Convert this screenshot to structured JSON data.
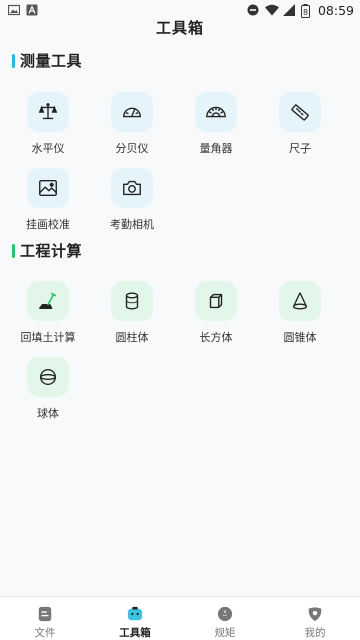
{
  "status_bar": {
    "time": "08:59",
    "battery_level": "8"
  },
  "header": {
    "title": "工具箱"
  },
  "sections": [
    {
      "title": "测量工具",
      "accent": "#2ab7e0",
      "tools": [
        {
          "label": "水平仪",
          "icon": "level-scale-icon"
        },
        {
          "label": "分贝仪",
          "icon": "decibel-meter-icon"
        },
        {
          "label": "量角器",
          "icon": "protractor-icon"
        },
        {
          "label": "尺子",
          "icon": "ruler-icon"
        },
        {
          "label": "挂画校准",
          "icon": "picture-frame-icon"
        },
        {
          "label": "考勤相机",
          "icon": "camera-icon"
        }
      ]
    },
    {
      "title": "工程计算",
      "accent": "#2ec26a",
      "tools": [
        {
          "label": "回填土计算",
          "icon": "shovel-icon"
        },
        {
          "label": "圆柱体",
          "icon": "cylinder-icon"
        },
        {
          "label": "长方体",
          "icon": "cuboid-icon"
        },
        {
          "label": "圆锥体",
          "icon": "cone-icon"
        },
        {
          "label": "球体",
          "icon": "sphere-icon"
        }
      ]
    }
  ],
  "bottom_nav": {
    "items": [
      {
        "label": "文件",
        "icon": "file-icon",
        "active": false
      },
      {
        "label": "工具箱",
        "icon": "toolbox-icon",
        "active": true
      },
      {
        "label": "规矩",
        "icon": "compass-icon",
        "active": false
      },
      {
        "label": "我的",
        "icon": "profile-icon",
        "active": false
      }
    ]
  }
}
